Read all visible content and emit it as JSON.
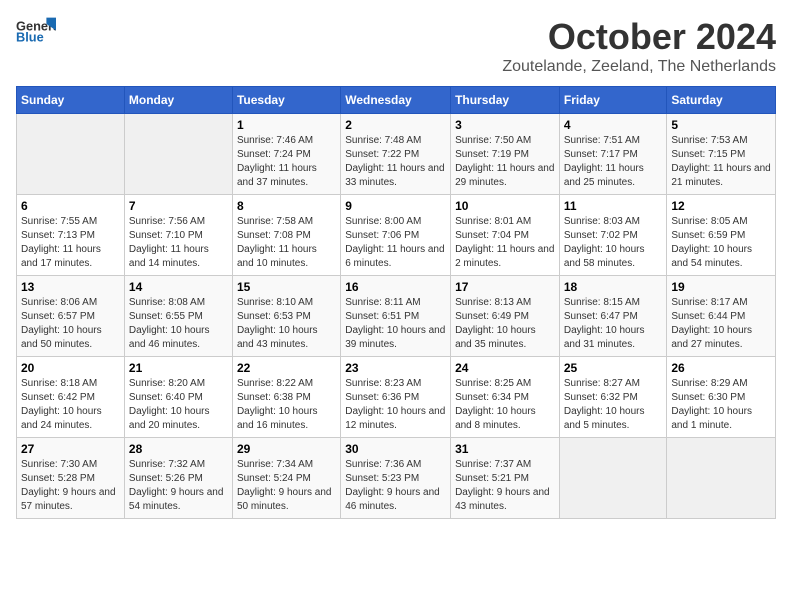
{
  "header": {
    "logo_general": "General",
    "logo_blue": "Blue",
    "month_title": "October 2024",
    "location": "Zoutelande, Zeeland, The Netherlands"
  },
  "days_of_week": [
    "Sunday",
    "Monday",
    "Tuesday",
    "Wednesday",
    "Thursday",
    "Friday",
    "Saturday"
  ],
  "weeks": [
    [
      {
        "day": "",
        "sunrise": "",
        "sunset": "",
        "daylight": ""
      },
      {
        "day": "",
        "sunrise": "",
        "sunset": "",
        "daylight": ""
      },
      {
        "day": "1",
        "sunrise": "Sunrise: 7:46 AM",
        "sunset": "Sunset: 7:24 PM",
        "daylight": "Daylight: 11 hours and 37 minutes."
      },
      {
        "day": "2",
        "sunrise": "Sunrise: 7:48 AM",
        "sunset": "Sunset: 7:22 PM",
        "daylight": "Daylight: 11 hours and 33 minutes."
      },
      {
        "day": "3",
        "sunrise": "Sunrise: 7:50 AM",
        "sunset": "Sunset: 7:19 PM",
        "daylight": "Daylight: 11 hours and 29 minutes."
      },
      {
        "day": "4",
        "sunrise": "Sunrise: 7:51 AM",
        "sunset": "Sunset: 7:17 PM",
        "daylight": "Daylight: 11 hours and 25 minutes."
      },
      {
        "day": "5",
        "sunrise": "Sunrise: 7:53 AM",
        "sunset": "Sunset: 7:15 PM",
        "daylight": "Daylight: 11 hours and 21 minutes."
      }
    ],
    [
      {
        "day": "6",
        "sunrise": "Sunrise: 7:55 AM",
        "sunset": "Sunset: 7:13 PM",
        "daylight": "Daylight: 11 hours and 17 minutes."
      },
      {
        "day": "7",
        "sunrise": "Sunrise: 7:56 AM",
        "sunset": "Sunset: 7:10 PM",
        "daylight": "Daylight: 11 hours and 14 minutes."
      },
      {
        "day": "8",
        "sunrise": "Sunrise: 7:58 AM",
        "sunset": "Sunset: 7:08 PM",
        "daylight": "Daylight: 11 hours and 10 minutes."
      },
      {
        "day": "9",
        "sunrise": "Sunrise: 8:00 AM",
        "sunset": "Sunset: 7:06 PM",
        "daylight": "Daylight: 11 hours and 6 minutes."
      },
      {
        "day": "10",
        "sunrise": "Sunrise: 8:01 AM",
        "sunset": "Sunset: 7:04 PM",
        "daylight": "Daylight: 11 hours and 2 minutes."
      },
      {
        "day": "11",
        "sunrise": "Sunrise: 8:03 AM",
        "sunset": "Sunset: 7:02 PM",
        "daylight": "Daylight: 10 hours and 58 minutes."
      },
      {
        "day": "12",
        "sunrise": "Sunrise: 8:05 AM",
        "sunset": "Sunset: 6:59 PM",
        "daylight": "Daylight: 10 hours and 54 minutes."
      }
    ],
    [
      {
        "day": "13",
        "sunrise": "Sunrise: 8:06 AM",
        "sunset": "Sunset: 6:57 PM",
        "daylight": "Daylight: 10 hours and 50 minutes."
      },
      {
        "day": "14",
        "sunrise": "Sunrise: 8:08 AM",
        "sunset": "Sunset: 6:55 PM",
        "daylight": "Daylight: 10 hours and 46 minutes."
      },
      {
        "day": "15",
        "sunrise": "Sunrise: 8:10 AM",
        "sunset": "Sunset: 6:53 PM",
        "daylight": "Daylight: 10 hours and 43 minutes."
      },
      {
        "day": "16",
        "sunrise": "Sunrise: 8:11 AM",
        "sunset": "Sunset: 6:51 PM",
        "daylight": "Daylight: 10 hours and 39 minutes."
      },
      {
        "day": "17",
        "sunrise": "Sunrise: 8:13 AM",
        "sunset": "Sunset: 6:49 PM",
        "daylight": "Daylight: 10 hours and 35 minutes."
      },
      {
        "day": "18",
        "sunrise": "Sunrise: 8:15 AM",
        "sunset": "Sunset: 6:47 PM",
        "daylight": "Daylight: 10 hours and 31 minutes."
      },
      {
        "day": "19",
        "sunrise": "Sunrise: 8:17 AM",
        "sunset": "Sunset: 6:44 PM",
        "daylight": "Daylight: 10 hours and 27 minutes."
      }
    ],
    [
      {
        "day": "20",
        "sunrise": "Sunrise: 8:18 AM",
        "sunset": "Sunset: 6:42 PM",
        "daylight": "Daylight: 10 hours and 24 minutes."
      },
      {
        "day": "21",
        "sunrise": "Sunrise: 8:20 AM",
        "sunset": "Sunset: 6:40 PM",
        "daylight": "Daylight: 10 hours and 20 minutes."
      },
      {
        "day": "22",
        "sunrise": "Sunrise: 8:22 AM",
        "sunset": "Sunset: 6:38 PM",
        "daylight": "Daylight: 10 hours and 16 minutes."
      },
      {
        "day": "23",
        "sunrise": "Sunrise: 8:23 AM",
        "sunset": "Sunset: 6:36 PM",
        "daylight": "Daylight: 10 hours and 12 minutes."
      },
      {
        "day": "24",
        "sunrise": "Sunrise: 8:25 AM",
        "sunset": "Sunset: 6:34 PM",
        "daylight": "Daylight: 10 hours and 8 minutes."
      },
      {
        "day": "25",
        "sunrise": "Sunrise: 8:27 AM",
        "sunset": "Sunset: 6:32 PM",
        "daylight": "Daylight: 10 hours and 5 minutes."
      },
      {
        "day": "26",
        "sunrise": "Sunrise: 8:29 AM",
        "sunset": "Sunset: 6:30 PM",
        "daylight": "Daylight: 10 hours and 1 minute."
      }
    ],
    [
      {
        "day": "27",
        "sunrise": "Sunrise: 7:30 AM",
        "sunset": "Sunset: 5:28 PM",
        "daylight": "Daylight: 9 hours and 57 minutes."
      },
      {
        "day": "28",
        "sunrise": "Sunrise: 7:32 AM",
        "sunset": "Sunset: 5:26 PM",
        "daylight": "Daylight: 9 hours and 54 minutes."
      },
      {
        "day": "29",
        "sunrise": "Sunrise: 7:34 AM",
        "sunset": "Sunset: 5:24 PM",
        "daylight": "Daylight: 9 hours and 50 minutes."
      },
      {
        "day": "30",
        "sunrise": "Sunrise: 7:36 AM",
        "sunset": "Sunset: 5:23 PM",
        "daylight": "Daylight: 9 hours and 46 minutes."
      },
      {
        "day": "31",
        "sunrise": "Sunrise: 7:37 AM",
        "sunset": "Sunset: 5:21 PM",
        "daylight": "Daylight: 9 hours and 43 minutes."
      },
      {
        "day": "",
        "sunrise": "",
        "sunset": "",
        "daylight": ""
      },
      {
        "day": "",
        "sunrise": "",
        "sunset": "",
        "daylight": ""
      }
    ]
  ]
}
